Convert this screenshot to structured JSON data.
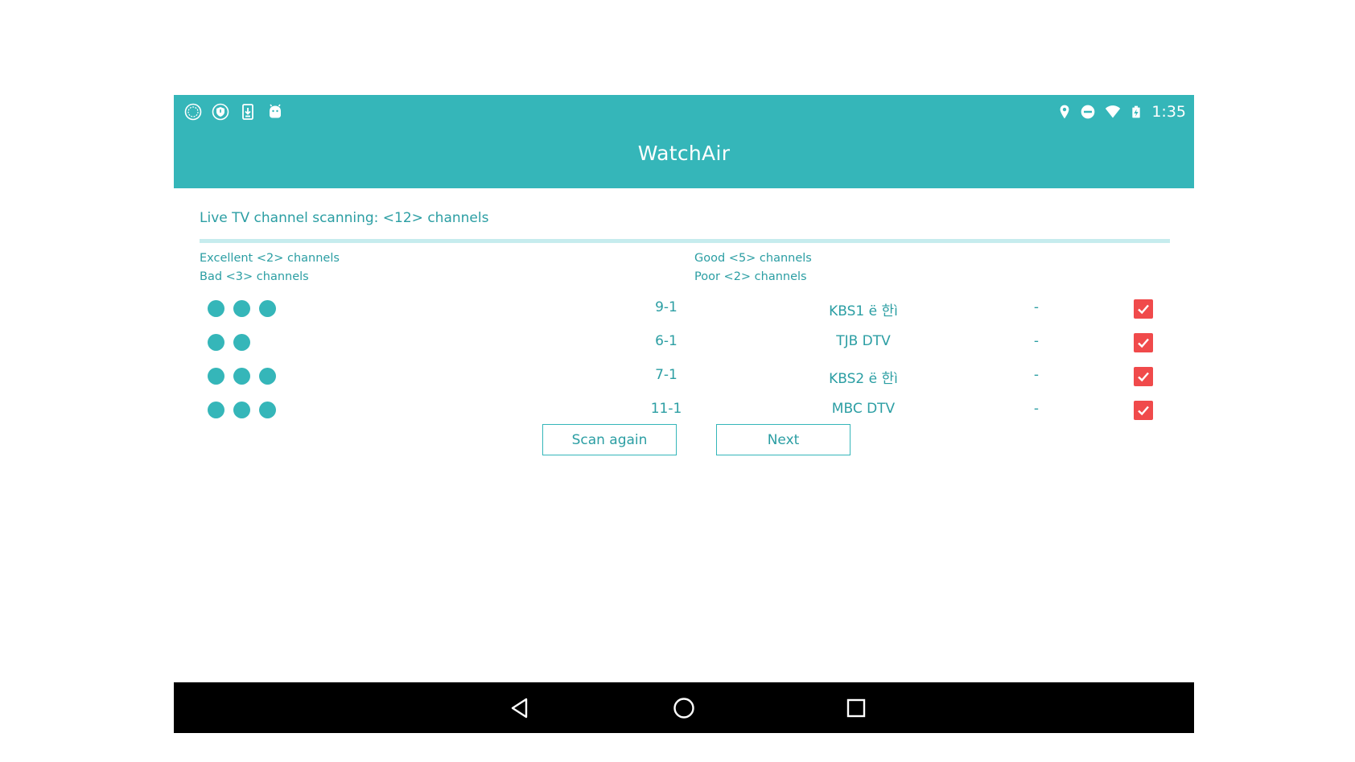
{
  "status_bar": {
    "left_icons": [
      "speedometer-icon",
      "shield-icon",
      "download-icon",
      "android-icon"
    ],
    "right_icons": [
      "location-icon",
      "do-not-disturb-icon",
      "wifi-icon",
      "battery-charging-icon"
    ],
    "time": "1:35"
  },
  "app": {
    "title": "WatchAir"
  },
  "scan": {
    "title": "Live TV channel scanning: <12> channels",
    "summary": {
      "excellent": "Excellent <2> channels",
      "good": "Good <5> channels",
      "bad": "Bad <3> channels",
      "poor": "Poor <2> channels"
    }
  },
  "channels": [
    {
      "signal_dots": 3,
      "number": "9-1",
      "name": "KBS1 ë 한ì ",
      "extra": "-",
      "checked": true
    },
    {
      "signal_dots": 2,
      "number": "6-1",
      "name": "TJB DTV",
      "extra": "-",
      "checked": true
    },
    {
      "signal_dots": 3,
      "number": "7-1",
      "name": "KBS2 ë 한ì ",
      "extra": "-",
      "checked": true
    },
    {
      "signal_dots": 3,
      "number": "11-1",
      "name": "MBC DTV",
      "extra": "-",
      "checked": true
    }
  ],
  "buttons": {
    "scan_again": "Scan again",
    "next": "Next"
  },
  "nav_bar": {
    "icons": [
      "back-icon",
      "home-icon",
      "recents-icon"
    ]
  },
  "colors": {
    "primary": "#35b6b9",
    "text": "#2b9ea3",
    "checkbox": "#f04a4b",
    "divider": "#c6ecee"
  }
}
